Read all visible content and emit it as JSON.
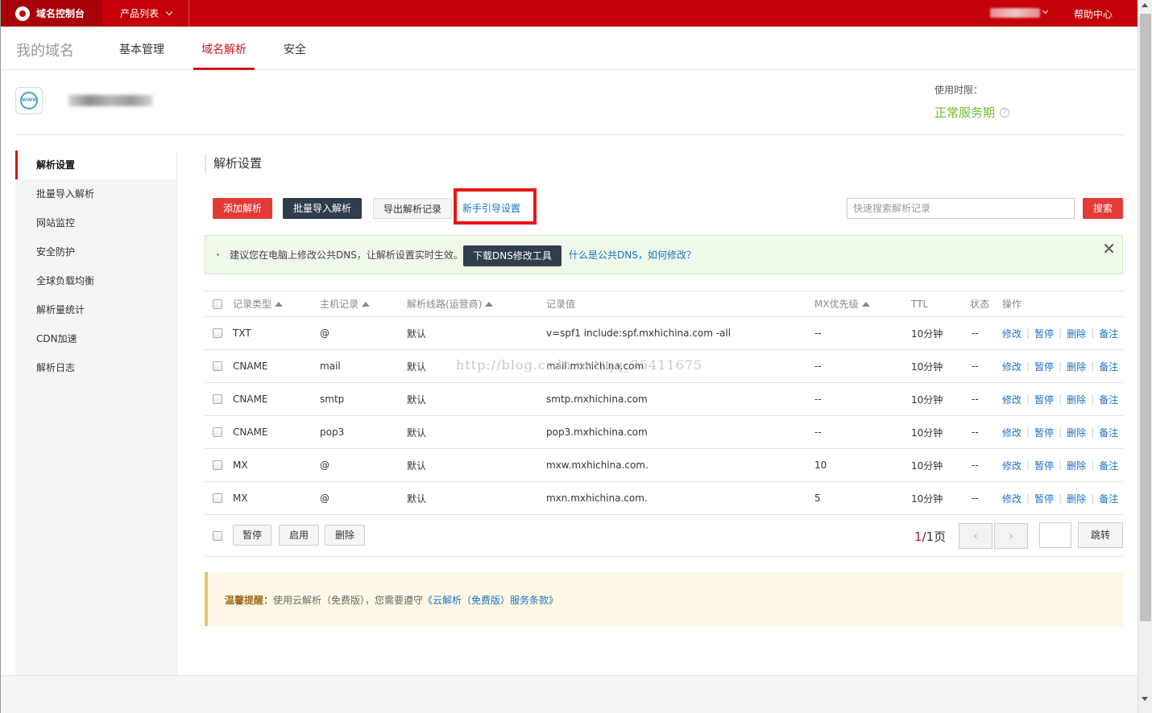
{
  "topbar": {
    "logo_text": "域名控制台",
    "products_label": "产品列表",
    "help_label": "帮助中心"
  },
  "subnav": {
    "my_domain": "我的域名",
    "tabs": [
      {
        "label": "基本管理"
      },
      {
        "label": "域名解析"
      },
      {
        "label": "安全"
      }
    ]
  },
  "domain_icon_text": "WWW",
  "service": {
    "label": "使用时限：",
    "status": "正常服务期",
    "help_icon": "?"
  },
  "sidebar": {
    "items": [
      {
        "label": "解析设置"
      },
      {
        "label": "批量导入解析"
      },
      {
        "label": "网站监控"
      },
      {
        "label": "安全防护"
      },
      {
        "label": "全球负载均衡"
      },
      {
        "label": "解析量统计"
      },
      {
        "label": "CDN加速"
      },
      {
        "label": "解析日志"
      }
    ]
  },
  "main": {
    "title": "解析设置",
    "buttons": {
      "add": "添加解析",
      "batch_import": "批量导入解析",
      "export": "导出解析记录",
      "guide": "新手引导设置",
      "search": "搜索"
    },
    "search_placeholder": "快速搜索解析记录"
  },
  "alert": {
    "text": "建议您在电脑上修改公共DNS，让解析设置实时生效。",
    "download_button": "下载DNS修改工具",
    "link": "什么是公共DNS，如何修改？",
    "close": "✕"
  },
  "table": {
    "headers": {
      "type": "记录类型",
      "host": "主机记录",
      "line": "解析线路(运营商)",
      "value": "记录值",
      "mx": "MX优先级",
      "ttl": "TTL",
      "status": "状态",
      "ops": "操作"
    },
    "actions": {
      "edit": "修改",
      "pause": "暂停",
      "delete": "删除",
      "note": "备注"
    },
    "rows": [
      {
        "type": "TXT",
        "host": "@",
        "line": "默认",
        "value": "v=spf1 include:spf.mxhichina.com -all",
        "mx": "--",
        "ttl": "10分钟",
        "status": "--"
      },
      {
        "type": "CNAME",
        "host": "mail",
        "line": "默认",
        "value": "mail.mxhichina.com",
        "mx": "--",
        "ttl": "10分钟",
        "status": "--"
      },
      {
        "type": "CNAME",
        "host": "smtp",
        "line": "默认",
        "value": "smtp.mxhichina.com",
        "mx": "--",
        "ttl": "10分钟",
        "status": "--"
      },
      {
        "type": "CNAME",
        "host": "pop3",
        "line": "默认",
        "value": "pop3.mxhichina.com",
        "mx": "--",
        "ttl": "10分钟",
        "status": "--"
      },
      {
        "type": "MX",
        "host": "@",
        "line": "默认",
        "value": "mxw.mxhichina.com.",
        "mx": "10",
        "ttl": "10分钟",
        "status": "--"
      },
      {
        "type": "MX",
        "host": "@",
        "line": "默认",
        "value": "mxn.mxhichina.com.",
        "mx": "5",
        "ttl": "10分钟",
        "status": "--"
      }
    ]
  },
  "footer": {
    "pause": "暂停",
    "enable": "启用",
    "delete": "删除",
    "page_current": "1",
    "page_total": "/1页",
    "prev": "‹",
    "next": "›",
    "jump": "跳转"
  },
  "notice": {
    "label": "温馨提醒：",
    "text": "使用云解析（免费版），您需要遵守",
    "link": "《云解析（免费版）服务条款》"
  },
  "watermark": "http://blog.csdn.net/qq_35411675"
}
